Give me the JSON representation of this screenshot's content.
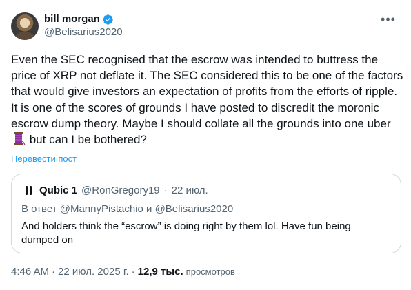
{
  "post": {
    "author": {
      "display_name": "bill morgan",
      "handle": "@Belisarius2020",
      "verified": true
    },
    "text_parts": [
      "Even the SEC recognised that the escrow was intended to buttress the price of XRP not deflate it. The SEC considered this to be one of the factors that would give investors an expectation of profits from the efforts of ripple. It is one of the scores of grounds I have posted to discredit the moronic escrow dump theory. Maybe I should collate all the grounds into one uber ",
      " but can I be bothered?"
    ],
    "emoji": "thread-spool",
    "translate_label": "Перевести пост",
    "quote": {
      "author_name": "Qubic 1",
      "author_handle": "@RonGregory19",
      "separator": "·",
      "date": "22 июл.",
      "reply_to": "В ответ @MannyPistachio и @Belisarius2020",
      "text": "And holders think the “escrow” is doing right by them lol. Have fun being dumped on"
    },
    "time": "4:46 AM",
    "separator": "·",
    "date": "22 июл. 2025 г.",
    "views_count": "12,9 тыс.",
    "views_label": "просмотров"
  },
  "colors": {
    "accent": "#1d9bf0",
    "secondary_text": "#536471",
    "primary_text": "#0f1419",
    "border": "#cfd9de"
  }
}
